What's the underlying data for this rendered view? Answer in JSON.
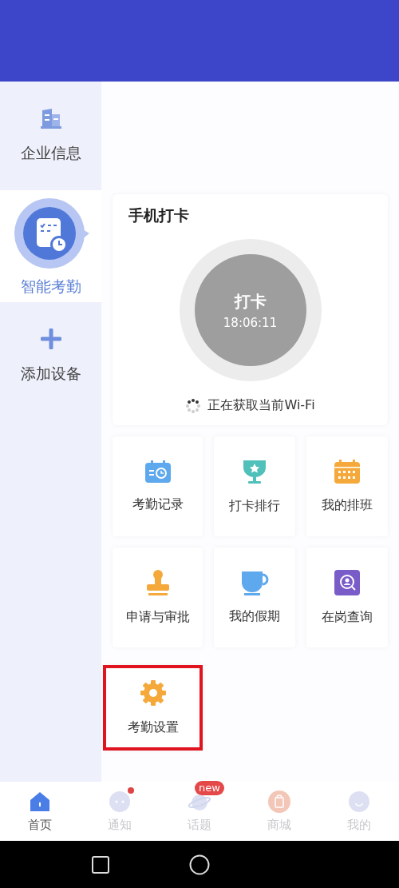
{
  "sidebar": {
    "items": [
      {
        "label": "企业信息",
        "selected": false
      },
      {
        "label": "智能考勤",
        "selected": true
      },
      {
        "label": "添加设备",
        "selected": false
      }
    ]
  },
  "punch_card": {
    "title": "手机打卡",
    "button_label": "打卡",
    "time": "18:06:11",
    "status": "正在获取当前Wi-Fi"
  },
  "tiles": [
    {
      "label": "考勤记录",
      "highlighted": false
    },
    {
      "label": "打卡排行",
      "highlighted": false
    },
    {
      "label": "我的排班",
      "highlighted": false
    },
    {
      "label": "申请与审批",
      "highlighted": false
    },
    {
      "label": "我的假期",
      "highlighted": false
    },
    {
      "label": "在岗查询",
      "highlighted": false
    },
    {
      "label": "考勤设置",
      "highlighted": true
    }
  ],
  "tab_bar": [
    {
      "label": "首页",
      "selected": true
    },
    {
      "label": "通知",
      "selected": false,
      "dot": true
    },
    {
      "label": "话题",
      "selected": false,
      "badge": "new"
    },
    {
      "label": "商城",
      "selected": false
    },
    {
      "label": "我的",
      "selected": false
    }
  ]
}
